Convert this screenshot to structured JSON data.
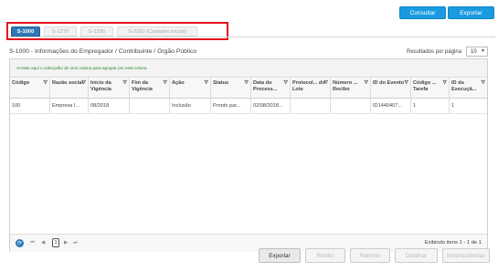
{
  "header": {
    "consultar_label": "Consultar",
    "exportar_label": "Exportar"
  },
  "tabs": [
    {
      "label": "S-1000",
      "active": true
    },
    {
      "label": "S-1270",
      "active": false
    },
    {
      "label": "S-1295",
      "active": false
    },
    {
      "label": "S-2200 (Cadastro Inicial)",
      "active": false
    }
  ],
  "page_title": "S-1000 - Informações do Empregador / Contribuinte / Órgão Público",
  "results_per_page": {
    "label": "Resultados por página",
    "value": "10"
  },
  "grid": {
    "group_hint": "Arraste aqui o cabeçalho de uma coluna para agrupar por esta coluna",
    "columns": [
      "Código",
      "Razão social",
      "Início da Vigência",
      "Fim da Vigência",
      "Ação",
      "Status",
      "Data do Process...",
      "Protocol... do Lote",
      "Número ... Recibo",
      "ID do Evento",
      "Código ... Tarefa",
      "ID da Execuçã..."
    ],
    "rows": [
      [
        "100",
        "Empresa I...",
        "08/2018",
        "",
        "Inclusão",
        "Pronto par...",
        "02/08/2018...",
        "",
        "",
        "ID1440407...",
        "1",
        "1"
      ]
    ]
  },
  "pager": {
    "first": "⏮",
    "prev": "◀",
    "page": "1",
    "next": "▶",
    "last": "⏭",
    "info": "Exibindo itens 1 - 1 de 1"
  },
  "footer_buttons": [
    {
      "label": "Exportar",
      "enabled": true
    },
    {
      "label": "Recibo",
      "enabled": false
    },
    {
      "label": "Retorno",
      "enabled": false
    },
    {
      "label": "Detalhar",
      "enabled": false
    },
    {
      "label": "Inconsistências",
      "enabled": false
    }
  ],
  "colors": {
    "accent": "#1a9ae0",
    "tab_active": "#2e78b8",
    "highlight_border": "#e3111c",
    "group_hint_text": "#2c8a2c"
  }
}
